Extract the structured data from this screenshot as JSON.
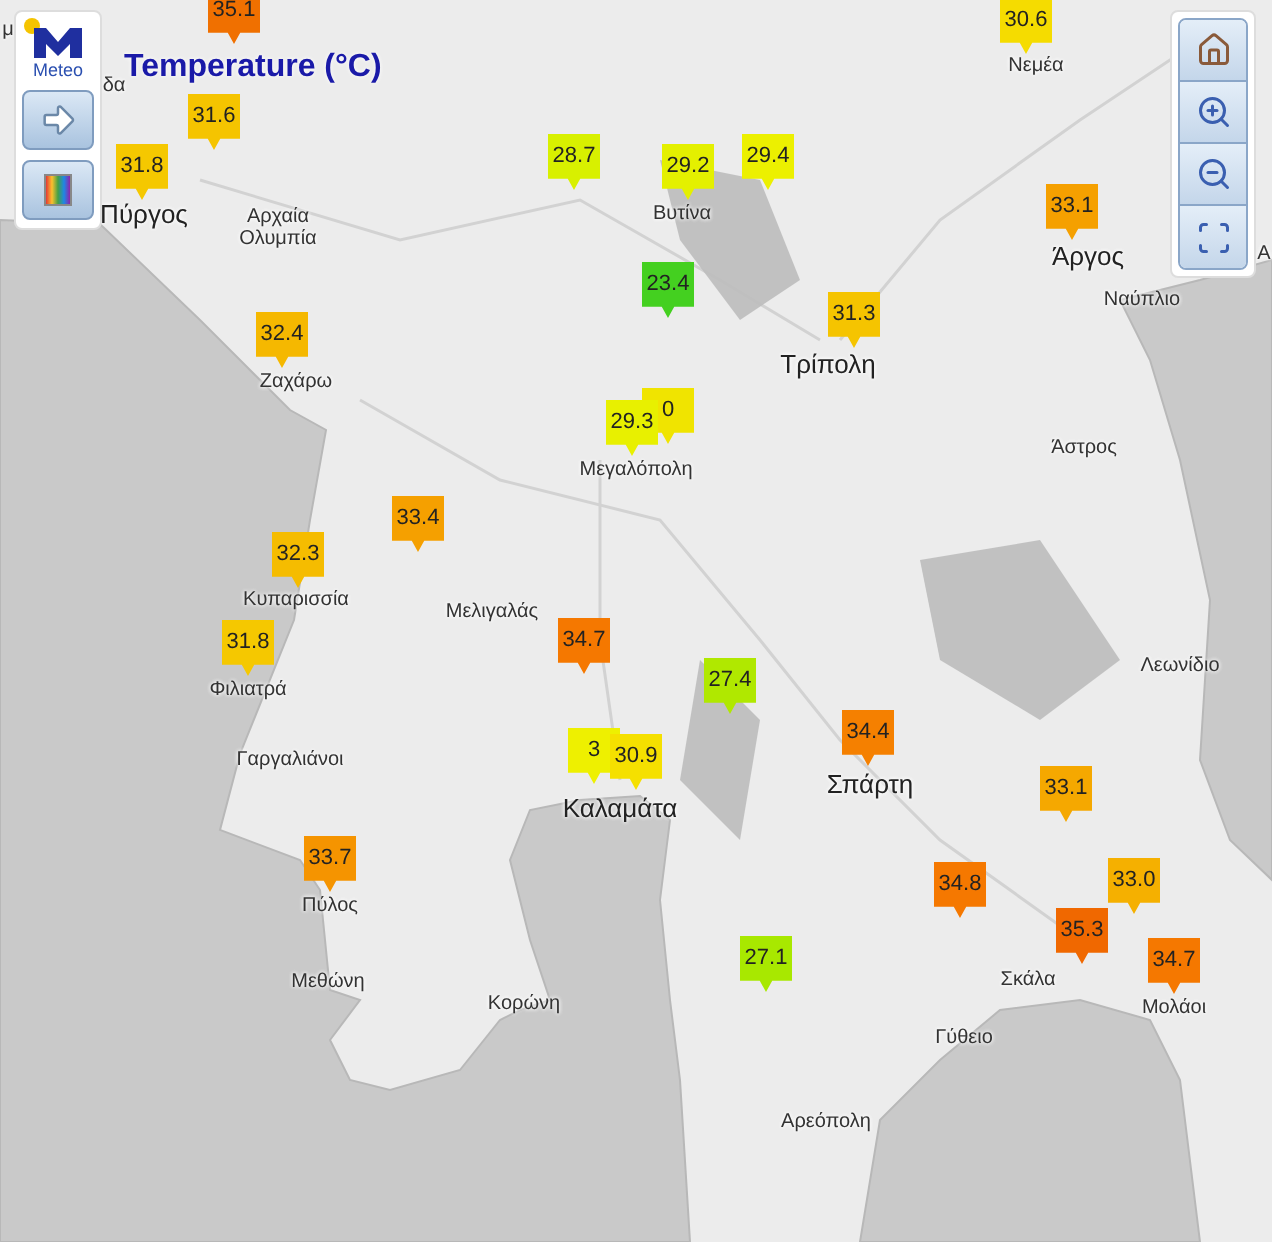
{
  "title": "Temperature (°C)",
  "logo": {
    "text": "Meteo"
  },
  "left_controls": [
    {
      "kind": "next"
    },
    {
      "kind": "legend"
    }
  ],
  "right_controls": [
    {
      "kind": "home"
    },
    {
      "kind": "zoom_in"
    },
    {
      "kind": "zoom_out"
    },
    {
      "kind": "extent"
    }
  ],
  "markers": [
    {
      "value": "35.1",
      "color": "#f07000"
    },
    {
      "value": "31.6",
      "color": "#f5c400"
    },
    {
      "value": "31.8",
      "color": "#f5c800"
    },
    {
      "value": "28.7",
      "color": "#d8f000"
    },
    {
      "value": "29.2",
      "color": "#e4f000"
    },
    {
      "value": "29.4",
      "color": "#ecf000"
    },
    {
      "value": "30.6",
      "color": "#f5dc00"
    },
    {
      "value": "33.1",
      "color": "#f5a000"
    },
    {
      "value": "23.4",
      "color": "#44d020"
    },
    {
      "value": "31.3",
      "color": "#f5c400"
    },
    {
      "value": "32.4",
      "color": "#f5b800"
    },
    {
      "value": "0",
      "color": "#f0e400"
    },
    {
      "value": "29.3",
      "color": "#e8f000"
    },
    {
      "value": "33.4",
      "color": "#f5a000"
    },
    {
      "value": "32.3",
      "color": "#f5bc00"
    },
    {
      "value": "31.8",
      "color": "#f5c800"
    },
    {
      "value": "34.7",
      "color": "#f57800"
    },
    {
      "value": "27.4",
      "color": "#b0e800"
    },
    {
      "value": "34.4",
      "color": "#f58000"
    },
    {
      "value": "3",
      "color": "#eef000"
    },
    {
      "value": "30.9",
      "color": "#f5e000"
    },
    {
      "value": "33.1",
      "color": "#f5a800"
    },
    {
      "value": "33.7",
      "color": "#f59400"
    },
    {
      "value": "34.8",
      "color": "#f57800"
    },
    {
      "value": "33.0",
      "color": "#f5b000"
    },
    {
      "value": "35.3",
      "color": "#f06800"
    },
    {
      "value": "34.7",
      "color": "#f57800"
    },
    {
      "value": "27.1",
      "color": "#a8e800"
    }
  ],
  "places": [
    {
      "name": "μ",
      "kind": "town"
    },
    {
      "name": "δα",
      "kind": "town"
    },
    {
      "name": "Πύργος",
      "kind": "city"
    },
    {
      "name": "Αρχαία Ολυμπία",
      "kind": "town"
    },
    {
      "name": "Ζαχάρω",
      "kind": "town"
    },
    {
      "name": "Βυτίνα",
      "kind": "town"
    },
    {
      "name": "Τρίπολη",
      "kind": "city"
    },
    {
      "name": "Νεμέα",
      "kind": "town"
    },
    {
      "name": "Άργος",
      "kind": "city"
    },
    {
      "name": "Ναύπλιο",
      "kind": "town"
    },
    {
      "name": "Α",
      "kind": "town"
    },
    {
      "name": "Μεγαλόπολη",
      "kind": "town"
    },
    {
      "name": "Άστρος",
      "kind": "town"
    },
    {
      "name": "Κυπαρισσία",
      "kind": "town"
    },
    {
      "name": "Μελιγαλάς",
      "kind": "town"
    },
    {
      "name": "Φιλιατρά",
      "kind": "town"
    },
    {
      "name": "Λεωνίδιο",
      "kind": "town"
    },
    {
      "name": "Γαργαλιάνοι",
      "kind": "town"
    },
    {
      "name": "Καλαμάτα",
      "kind": "city"
    },
    {
      "name": "Σπάρτη",
      "kind": "city"
    },
    {
      "name": "Πύλος",
      "kind": "town"
    },
    {
      "name": "Μεθώνη",
      "kind": "town"
    },
    {
      "name": "Κορώνη",
      "kind": "town"
    },
    {
      "name": "Σκάλα",
      "kind": "town"
    },
    {
      "name": "Γύθειο",
      "kind": "town"
    },
    {
      "name": "Μολάοι",
      "kind": "town"
    },
    {
      "name": "Αρεόπολη",
      "kind": "town"
    }
  ]
}
